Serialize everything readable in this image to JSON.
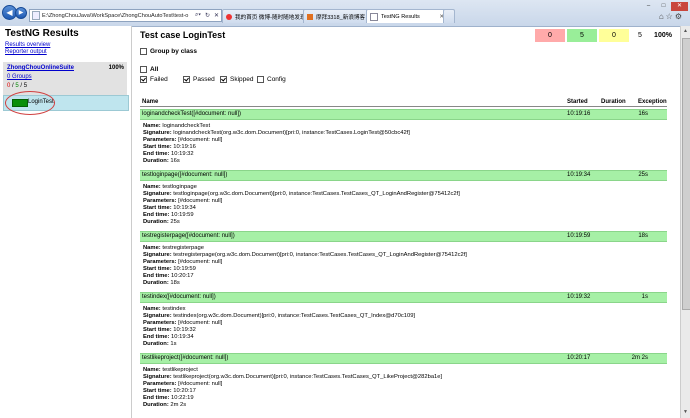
{
  "browser": {
    "url": "E:\\ZhongChouJava\\WorkSpace\\ZhongChouAutoTest\\test-o",
    "tabs": [
      {
        "label": "我的首页 微博-随时随地发现...",
        "active": false
      },
      {
        "label": "摩拜3318_新浪博客",
        "active": false
      },
      {
        "label": "TestNG Results",
        "active": true
      }
    ],
    "win_controls": [
      "–",
      "□",
      "✕"
    ]
  },
  "sidebar": {
    "title": "TestNG Results",
    "links": [
      "Results overview",
      "Reporter output"
    ],
    "suite": {
      "name": "ZhongChouOnlineSuite",
      "percent": "100%",
      "groups": "0 Groups",
      "counts": {
        "failed": "0",
        "sep1": " / ",
        "passed": "5",
        "sep2": " / ",
        "skipped": "5"
      }
    },
    "test_class": "LoginTest"
  },
  "main": {
    "title": "Test case LoginTest",
    "stats": [
      {
        "value": "0",
        "color": "#ffaaaa"
      },
      {
        "value": "5",
        "color": "#99ee99"
      },
      {
        "value": "0",
        "color": "#ffff99"
      },
      {
        "value": "5",
        "color": "#ffffff"
      },
      {
        "value": "100%",
        "color": "#ffffff"
      }
    ],
    "group_by_class": "Group by class",
    "all_label": "All",
    "filters": [
      "Failed",
      "Passed",
      "Skipped",
      "Config"
    ],
    "columns": [
      "Name",
      "Started",
      "Duration",
      "Exception"
    ],
    "rows": [
      {
        "name": "loginandcheckTest([#document: null])",
        "started": "10:19:16",
        "duration": "16s",
        "method": "loginandcheckTest",
        "signature": "loginandcheckTest(org.w3c.dom.Document)[pri:0, instance:TestCases.LoginTest@50cbc42f]",
        "parameters": "[#document: null]",
        "start_time": "10:19:16",
        "end_time": "10:19:32",
        "dur": "16s"
      },
      {
        "name": "testloginpage([#document: null])",
        "started": "10:19:34",
        "duration": "25s",
        "method": "testloginpage",
        "signature": "testloginpage(org.w3c.dom.Document)[pri:0, instance:TestCases.TestCases_QT_LoginAndRegister@75412c2f]",
        "parameters": "[#document: null]",
        "start_time": "10:19:34",
        "end_time": "10:19:59",
        "dur": "25s"
      },
      {
        "name": "testregisterpage([#document: null])",
        "started": "10:19:59",
        "duration": "18s",
        "method": "testregisterpage",
        "signature": "testregisterpage(org.w3c.dom.Document)[pri:0, instance:TestCases.TestCases_QT_LoginAndRegister@75412c2f]",
        "parameters": "[#document: null]",
        "start_time": "10:19:59",
        "end_time": "10:20:17",
        "dur": "18s"
      },
      {
        "name": "testindex([#document: null])",
        "started": "10:19:32",
        "duration": "1s",
        "method": "testindex",
        "signature": "testindex(org.w3c.dom.Document)[pri:0, instance:TestCases.TestCases_QT_Index@d70c109]",
        "parameters": "[#document: null]",
        "start_time": "10:19:32",
        "end_time": "10:19:34",
        "dur": "1s"
      },
      {
        "name": "testlikeproject([#document: null])",
        "started": "10:20:17",
        "duration": "2m 2s",
        "method": "testlikeproject",
        "signature": "testlikeproject(org.w3c.dom.Document)[pri:0, instance:TestCases.TestCases_QT_LikeProject@282ba1e]",
        "parameters": "[#document: null]",
        "start_time": "10:20:17",
        "end_time": "10:22:19",
        "dur": "2m 2s"
      }
    ],
    "detail_labels": {
      "name": "Name:",
      "signature": "Signature:",
      "parameters": "Parameters:",
      "start": "Start time:",
      "end": "End time:",
      "duration": "Duration:"
    }
  }
}
